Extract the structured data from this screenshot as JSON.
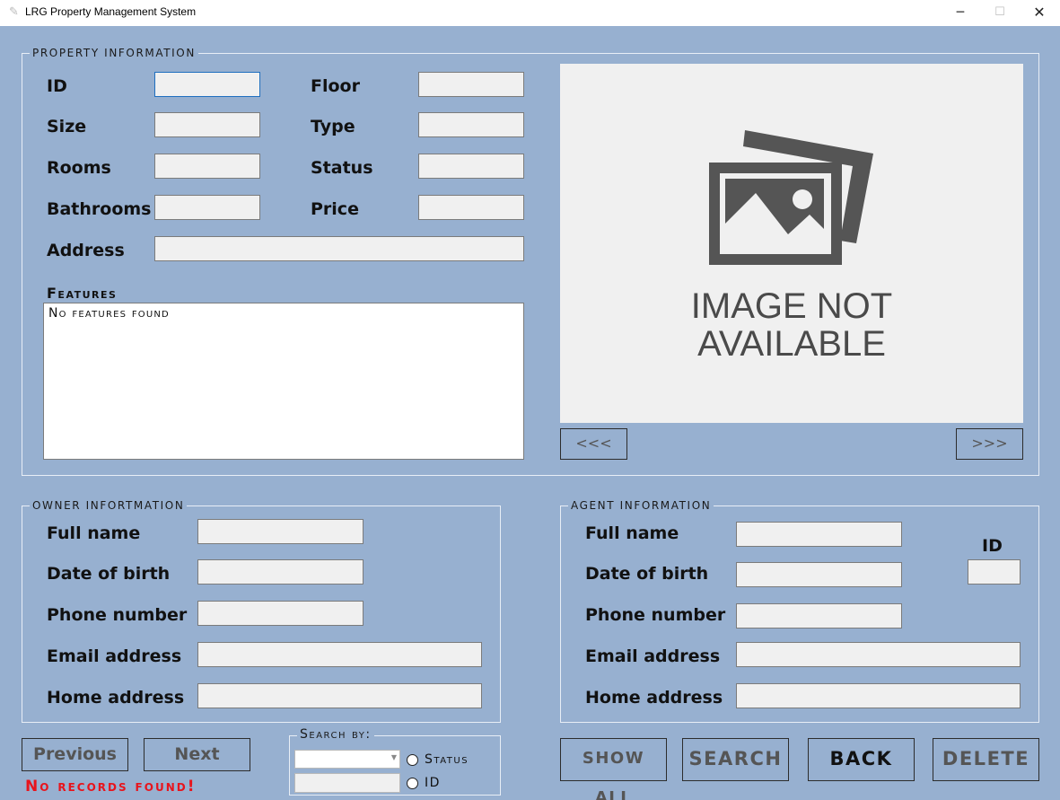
{
  "window": {
    "title": "LRG Property Management System",
    "minimize_glyph": "─",
    "maximize_glyph": "☐",
    "close_glyph": "✕",
    "app_icon": "feather-icon"
  },
  "property": {
    "legend": "PROPERTY INFORMATION",
    "id_label": "ID",
    "floor_label": "Floor",
    "size_label": "Size",
    "type_label": "Type",
    "rooms_label": "Rooms",
    "status_label": "Status",
    "bathrooms_label": "Bathrooms",
    "price_label": "Price",
    "address_label": "Address",
    "id_value": "",
    "floor_value": "",
    "size_value": "",
    "type_value": "",
    "rooms_value": "",
    "status_value": "",
    "bathrooms_value": "",
    "price_value": "",
    "address_value": "",
    "features_label": "Features",
    "features_text": "No features found"
  },
  "photo": {
    "placeholder_line1": "IMAGE NOT",
    "placeholder_line2": "AVAILABLE",
    "prev_label": "<<<",
    "next_label": ">>>",
    "icon": "image-placeholder-icon"
  },
  "owner": {
    "legend": "OWNER INFORTMATION",
    "full_name_label": "Full name",
    "dob_label": "Date of birth",
    "phone_label": "Phone number",
    "email_label": "Email address",
    "home_label": "Home address",
    "full_name_value": "",
    "dob_value": "",
    "phone_value": "",
    "email_value": "",
    "home_value": ""
  },
  "agent": {
    "legend": "AGENT INFORMATION",
    "full_name_label": "Full name",
    "dob_label": "Date of birth",
    "phone_label": "Phone number",
    "email_label": "Email address",
    "home_label": "Home address",
    "id_label": "ID",
    "full_name_value": "",
    "dob_value": "",
    "phone_value": "",
    "email_value": "",
    "home_value": "",
    "id_value": ""
  },
  "navigation": {
    "previous_label": "Previous",
    "next_label": "Next",
    "status_message": "No records found!"
  },
  "search": {
    "legend": "Search by:",
    "status_radio_label": "Status",
    "id_radio_label": "ID",
    "status_selected": "",
    "id_value": ""
  },
  "actions": {
    "show_all_label": "SHOW ALL",
    "search_label": "SEARCH",
    "back_label": "BACK",
    "delete_label": "DELETE"
  },
  "colors": {
    "background": "#97b0d0",
    "field": "#f0f0f0",
    "error_text": "#e8141c"
  }
}
